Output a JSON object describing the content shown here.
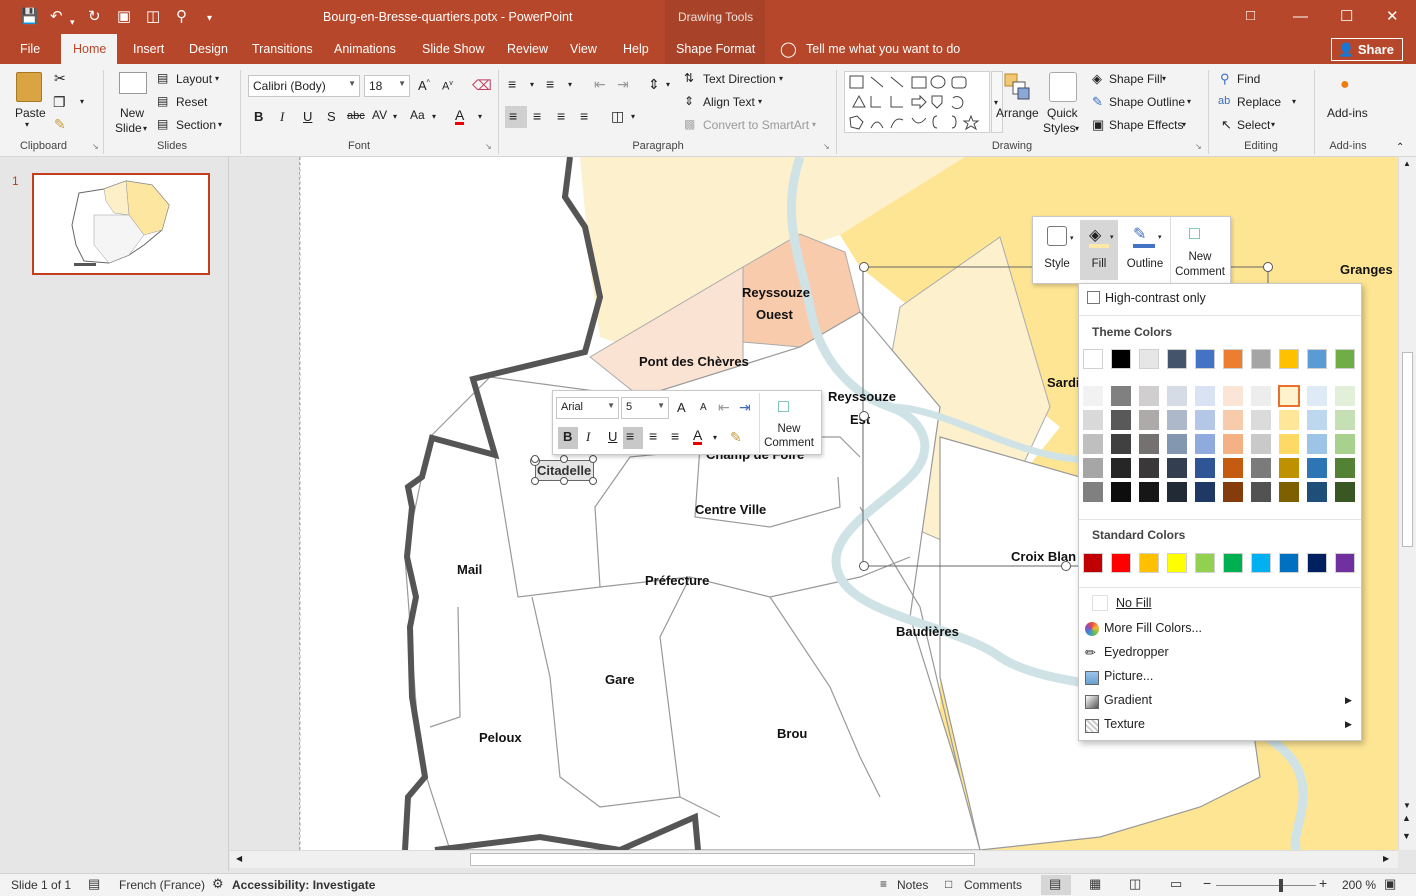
{
  "window": {
    "document_title": "Bourg-en-Bresse-quartiers.potx - PowerPoint",
    "contextual_group": "Drawing Tools",
    "share_label": "Share",
    "tell_me": "Tell me what you want to do"
  },
  "tabs": [
    "File",
    "Home",
    "Insert",
    "Design",
    "Transitions",
    "Animations",
    "Slide Show",
    "Review",
    "View",
    "Help",
    "Shape Format"
  ],
  "active_tab": "Home",
  "ribbon": {
    "clipboard": {
      "paste": "Paste",
      "group": "Clipboard"
    },
    "slides": {
      "new_slide_line1": "New",
      "new_slide_line2": "Slide",
      "layout": "Layout",
      "reset": "Reset",
      "section": "Section",
      "group": "Slides"
    },
    "font": {
      "family": "Calibri (Body)",
      "size": "18",
      "group": "Font"
    },
    "paragraph": {
      "text_direction": "Text Direction",
      "align_text": "Align Text",
      "convert_smartart": "Convert to SmartArt",
      "group": "Paragraph"
    },
    "drawing": {
      "arrange": "Arrange",
      "quick_styles_line1": "Quick",
      "quick_styles_line2": "Styles",
      "shape_fill": "Shape Fill",
      "shape_outline": "Shape Outline",
      "shape_effects": "Shape Effects",
      "group": "Drawing"
    },
    "editing": {
      "find": "Find",
      "replace": "Replace",
      "select": "Select",
      "group": "Editing"
    },
    "addins": {
      "label": "Add-ins",
      "group": "Add-ins"
    }
  },
  "thumbnail": {
    "number": "1"
  },
  "map_labels": {
    "reyssouze_ouest_1": "Reyssouze",
    "reyssouze_ouest_2": "Ouest",
    "pont_des_chevres": "Pont des Chèvres",
    "reyssouze_est_1": "Reyssouze",
    "reyssouze_est_2": "Est",
    "champ_de_foire": "Champ de Foire",
    "citadelle": "Citadelle",
    "centre_ville": "Centre Ville",
    "mail": "Mail",
    "prefecture": "Préfecture",
    "baudieres": "Baudières",
    "gare": "Gare",
    "peloux": "Peloux",
    "brou": "Brou",
    "granges": "Granges",
    "sardieres": "Sardi",
    "croix_blanche": "Croix Blan"
  },
  "mini_toolbar": {
    "font": "Arial",
    "size": "5",
    "new_comment_1": "New",
    "new_comment_2": "Comment"
  },
  "fill_toolbar": {
    "style": "Style",
    "fill": "Fill",
    "outline": "Outline",
    "new_comment_1": "New",
    "new_comment_2": "Comment"
  },
  "fill_menu": {
    "high_contrast": "High-contrast only",
    "theme_colors_title": "Theme Colors",
    "standard_colors_title": "Standard Colors",
    "theme_colors": [
      "#ffffff",
      "#000000",
      "#e7e6e6",
      "#44546a",
      "#4472c4",
      "#ed7d31",
      "#a5a5a5",
      "#ffc000",
      "#5b9bd5",
      "#70ad47"
    ],
    "theme_tints": [
      [
        "#f2f2f2",
        "#d9d9d9",
        "#bfbfbf",
        "#a6a6a6",
        "#808080"
      ],
      [
        "#808080",
        "#595959",
        "#404040",
        "#262626",
        "#0d0d0d"
      ],
      [
        "#d0cece",
        "#aeaaaa",
        "#757171",
        "#3a3838",
        "#171616"
      ],
      [
        "#d6dce5",
        "#adb9ca",
        "#8497b0",
        "#333f50",
        "#222a35"
      ],
      [
        "#dae3f3",
        "#b4c7e7",
        "#8faadc",
        "#2f5597",
        "#1f3864"
      ],
      [
        "#fbe5d6",
        "#f8cbad",
        "#f4b183",
        "#c55a11",
        "#843c0c"
      ],
      [
        "#ededed",
        "#dbdbdb",
        "#c9c9c9",
        "#7b7b7b",
        "#525252"
      ],
      [
        "#fff2cc",
        "#ffe699",
        "#ffd966",
        "#bf9000",
        "#7f6000"
      ],
      [
        "#deebf7",
        "#bdd7ee",
        "#9dc3e6",
        "#2e75b6",
        "#1f4e79"
      ],
      [
        "#e2f0d9",
        "#c5e0b4",
        "#a9d18e",
        "#548235",
        "#385723"
      ]
    ],
    "standard_colors": [
      "#c00000",
      "#ff0000",
      "#ffc000",
      "#ffff00",
      "#92d050",
      "#00b050",
      "#00b0f0",
      "#0070c0",
      "#002060",
      "#7030a0"
    ],
    "no_fill": "No Fill",
    "more_fill_colors": "More Fill Colors...",
    "eyedropper": "Eyedropper",
    "picture": "Picture...",
    "gradient": "Gradient",
    "texture": "Texture"
  },
  "status": {
    "slide": "Slide 1 of 1",
    "language": "French (France)",
    "accessibility": "Accessibility: Investigate",
    "notes": "Notes",
    "comments": "Comments",
    "zoom": "200 %"
  }
}
